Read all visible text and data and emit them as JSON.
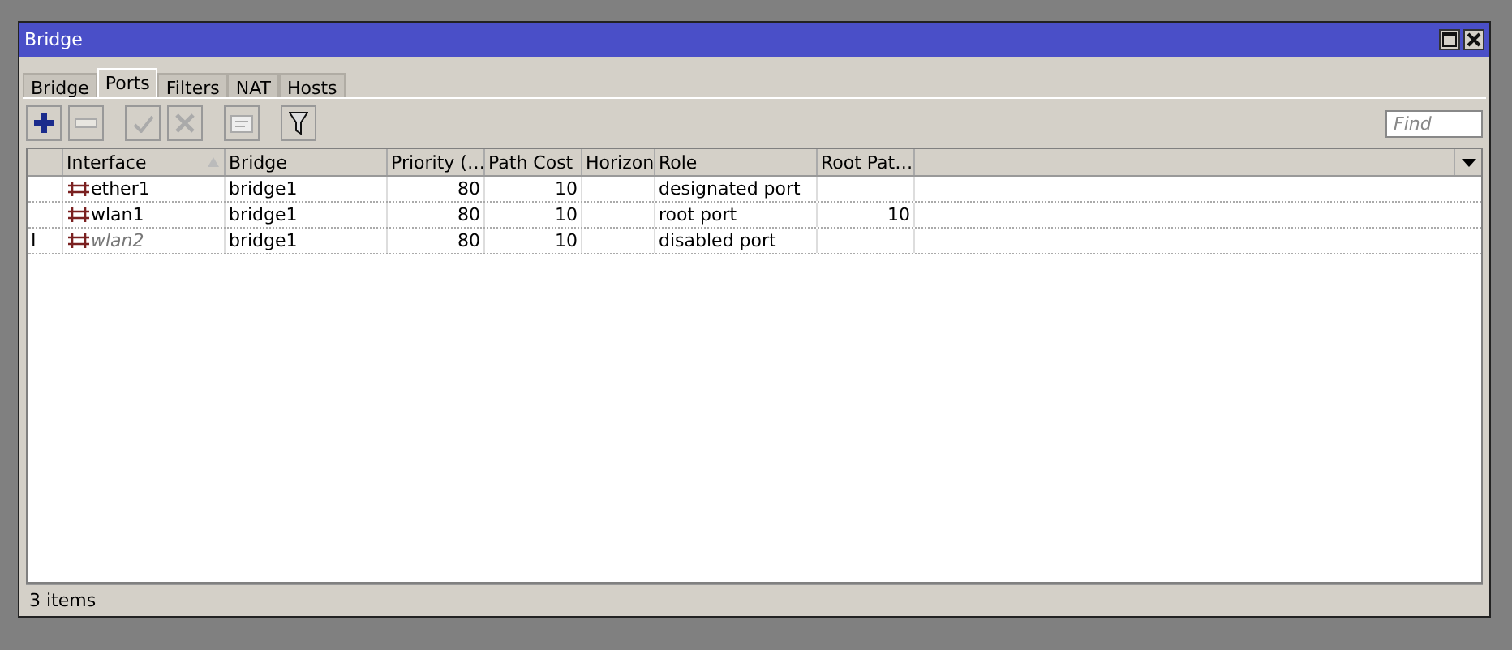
{
  "window": {
    "title": "Bridge"
  },
  "tabs": [
    {
      "label": "Bridge",
      "selected": false
    },
    {
      "label": "Ports",
      "selected": true
    },
    {
      "label": "Filters",
      "selected": false
    },
    {
      "label": "NAT",
      "selected": false
    },
    {
      "label": "Hosts",
      "selected": false
    }
  ],
  "toolbar": [
    {
      "kind": "add",
      "disabled": false
    },
    {
      "kind": "remove",
      "disabled": true
    },
    {
      "kind": "enable",
      "disabled": true
    },
    {
      "kind": "disable",
      "disabled": true
    },
    {
      "kind": "comment",
      "disabled": true
    },
    {
      "kind": "filter",
      "disabled": false
    }
  ],
  "search": {
    "placeholder": "Find"
  },
  "table": {
    "columns": [
      {
        "label": "Interface",
        "sorted": true
      },
      {
        "label": "Bridge",
        "sorted": false
      },
      {
        "label": "Priority (…",
        "sorted": false
      },
      {
        "label": "Path Cost",
        "sorted": false
      },
      {
        "label": "Horizon",
        "sorted": false
      },
      {
        "label": "Role",
        "sorted": false
      },
      {
        "label": "Root Pat…",
        "sorted": false
      }
    ],
    "rows": [
      {
        "flag": "",
        "disabled": false,
        "interface": "ether1",
        "bridge": "bridge1",
        "priority": "80",
        "path_cost": "10",
        "horizon": "",
        "role": "designated port",
        "root_path_cost": ""
      },
      {
        "flag": "",
        "disabled": false,
        "interface": "wlan1",
        "bridge": "bridge1",
        "priority": "80",
        "path_cost": "10",
        "horizon": "",
        "role": "root port",
        "root_path_cost": "10"
      },
      {
        "flag": "I",
        "disabled": true,
        "interface": "wlan2",
        "bridge": "bridge1",
        "priority": "80",
        "path_cost": "10",
        "horizon": "",
        "role": "disabled port",
        "root_path_cost": ""
      }
    ]
  },
  "status_bar": {
    "text": "3 items"
  }
}
